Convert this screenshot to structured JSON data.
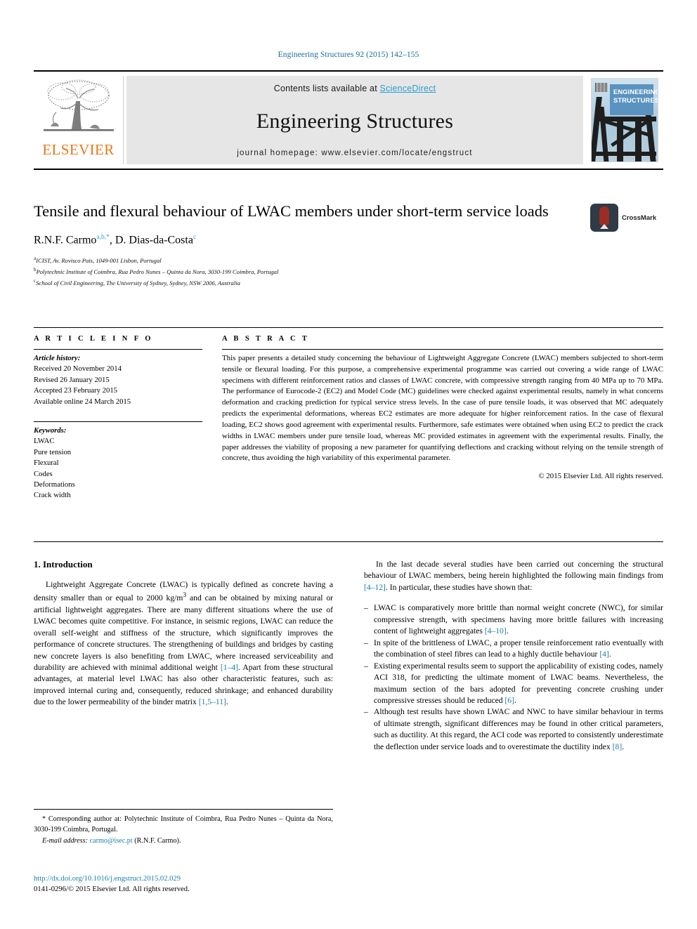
{
  "running_head": "Engineering Structures 92 (2015) 142–155",
  "masthead": {
    "publisher": "ELSEVIER",
    "contents_prefix": "Contents lists available at ",
    "sciencedirect": "ScienceDirect",
    "journal_title": "Engineering Structures",
    "homepage": "journal homepage: www.elsevier.com/locate/engstruct",
    "cover_title_line1": "Engineering",
    "cover_title_line2": "Structures"
  },
  "article": {
    "title": "Tensile and flexural behaviour of LWAC members under short-term service loads",
    "authors_part1": "R.N.F. Carmo",
    "authors_sup1": "a,b,",
    "authors_star": "*",
    "authors_part2": ", D. Dias-da-Costa",
    "authors_sup2": "c",
    "affiliations": [
      {
        "mark": "a",
        "text": "ICIST, Av. Rovisco Pais, 1049-001 Lisbon, Portugal"
      },
      {
        "mark": "b",
        "text": "Polytechnic Institute of Coimbra, Rua Pedro Nunes – Quinta da Nora, 3030-199 Coimbra, Portugal"
      },
      {
        "mark": "c",
        "text": "School of Civil Engineering, The University of Sydney, Sydney, NSW 2006, Australia"
      }
    ],
    "crossmark_label": "CrossMark"
  },
  "article_info": {
    "heading": "A R T I C L E   I N F O",
    "history_label": "Article history:",
    "history": [
      "Received 20 November 2014",
      "Revised 26 January 2015",
      "Accepted 23 February 2015",
      "Available online 24 March 2015"
    ],
    "keywords_label": "Keywords:",
    "keywords": [
      "LWAC",
      "Pure tension",
      "Flexural",
      "Codes",
      "Deformations",
      "Crack width"
    ]
  },
  "abstract": {
    "heading": "A B S T R A C T",
    "text": "This paper presents a detailed study concerning the behaviour of Lightweight Aggregate Concrete (LWAC) members subjected to short-term tensile or flexural loading. For this purpose, a comprehensive experimental programme was carried out covering a wide range of LWAC specimens with different reinforcement ratios and classes of LWAC concrete, with compressive strength ranging from 40 MPa up to 70 MPa. The performance of Eurocode-2 (EC2) and Model Code (MC) guidelines were checked against experimental results, namely in what concerns deformation and cracking prediction for typical service stress levels. In the case of pure tensile loads, it was observed that MC adequately predicts the experimental deformations, whereas EC2 estimates are more adequate for higher reinforcement ratios. In the case of flexural loading, EC2 shows good agreement with experimental results. Furthermore, safe estimates were obtained when using EC2 to predict the crack widths in LWAC members under pure tensile load, whereas MC provided estimates in agreement with the experimental results. Finally, the paper addresses the viability of proposing a new parameter for quantifying deflections and cracking without relying on the tensile strength of concrete, thus avoiding the high variability of this experimental parameter.",
    "copyright": "© 2015 Elsevier Ltd. All rights reserved."
  },
  "body": {
    "section_title": "1. Introduction",
    "left_para_1a": "Lightweight Aggregate Concrete (LWAC) is typically defined as concrete having a density smaller than or equal to 2000 kg/m",
    "left_para_1_sup": "3",
    "left_para_1b": " and can be obtained by mixing natural or artificial lightweight aggregates. There are many different situations where the use of LWAC becomes quite competitive. For instance, in seismic regions, LWAC can reduce the overall self-weight and stiffness of the structure, which significantly improves the performance of concrete structures. The strengthening of buildings and bridges by casting new concrete layers is also benefiting from LWAC, where increased serviceability and durability are achieved with minimal additional weight ",
    "left_ref_1": "[1–4]",
    "left_para_1c": ". Apart from these structural advantages, at material level LWAC has also other characteristic features, such as: improved internal curing and, consequently, reduced shrinkage; and enhanced durability due to the lower permeability of the binder matrix ",
    "left_ref_2": "[1,5–11]",
    "left_para_1d": ".",
    "right_para_1a": "In the last decade several studies have been carried out concerning the structural behaviour of LWAC members, being herein highlighted the following main findings from ",
    "right_ref_1": "[4–12]",
    "right_para_1b": ". In particular, these studies have shown that:",
    "bullets": [
      {
        "pre": "LWAC is comparatively more brittle than normal weight concrete (NWC), for similar compressive strength, with specimens having more brittle failures with increasing content of lightweight aggregates ",
        "ref": "[4–10]",
        "post": "."
      },
      {
        "pre": "In spite of the brittleness of LWAC, a proper tensile reinforcement ratio eventually with the combination of steel fibres can lead to a highly ductile behaviour ",
        "ref": "[4]",
        "post": "."
      },
      {
        "pre": "Existing experimental results seem to support the applicability of existing codes, namely ACI 318, for predicting the ultimate moment of LWAC beams. Nevertheless, the maximum section of the bars adopted for preventing concrete crushing under compressive stresses should be reduced ",
        "ref": "[6]",
        "post": "."
      },
      {
        "pre": "Although test results have shown LWAC and NWC to have similar behaviour in terms of ultimate strength, significant differences may be found in other critical parameters, such as ductility. At this regard, the ACI code was reported to consistently underestimate the deflection under service loads and to overestimate the ductility index ",
        "ref": "[8]",
        "post": "."
      }
    ]
  },
  "footnote": {
    "corresponding": "* Corresponding author at: Polytechnic Institute of Coimbra, Rua Pedro Nunes – Quinta da Nora, 3030-199 Coimbra, Portugal.",
    "email_label": "E-mail address:",
    "email": "carmo@isec.pt",
    "email_owner": "(R.N.F. Carmo)."
  },
  "doi_block": {
    "doi_url": "http://dx.doi.org/10.1016/j.engstruct.2015.02.029",
    "issn_line": "0141-0296/© 2015 Elsevier Ltd. All rights reserved."
  },
  "colors": {
    "link": "#1a7fa8",
    "running_head": "#1a6b9c",
    "sciencedirect": "#2a9fd0",
    "elsevier_orange": "#e77817",
    "cover_blue": "#5b93c0"
  }
}
